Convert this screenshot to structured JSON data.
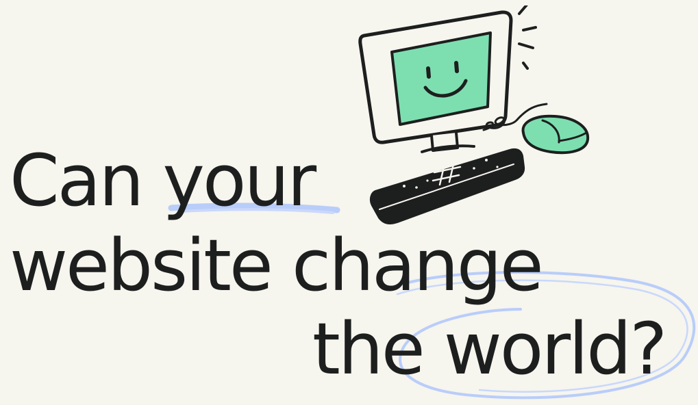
{
  "headline": {
    "line1": "Can your",
    "line2": "website change",
    "line3": "the world?"
  },
  "illustration": {
    "icon": "smiling-computer-icon",
    "screen_color": "#7ddfb0",
    "mouse_color": "#7ddfb0",
    "outline_color": "#1d1f1f"
  },
  "accents": {
    "underline_color": "#b9cdfa",
    "circle_color": "#b9cdfa"
  },
  "background_color": "#f6f5ee"
}
